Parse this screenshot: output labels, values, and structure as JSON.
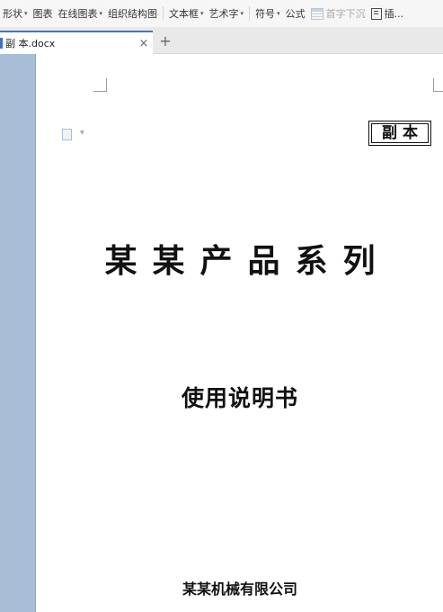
{
  "ribbon": {
    "items": [
      {
        "label": "形状",
        "dropdown": true
      },
      {
        "label": "图表",
        "dropdown": false
      },
      {
        "label": "在线图表",
        "dropdown": true
      },
      {
        "label": "组织结构图",
        "dropdown": false
      },
      {
        "label": "文本框",
        "dropdown": true
      },
      {
        "label": "艺术字",
        "dropdown": true
      },
      {
        "label": "符号",
        "dropdown": true
      },
      {
        "label": "公式",
        "dropdown": false
      },
      {
        "label": "首字下沉",
        "dropdown": false
      },
      {
        "label": "插...",
        "dropdown": false
      }
    ]
  },
  "tabs": {
    "active_title": "副 本.docx",
    "close_glyph": "×",
    "new_glyph": "+"
  },
  "document": {
    "stamp": "副本",
    "title": "某某产品系列",
    "subtitle": "使用说明书",
    "company": "某某机械有限公司"
  },
  "colors": {
    "accent": "#3b78c8",
    "side_pane": "#a8bdd6"
  }
}
